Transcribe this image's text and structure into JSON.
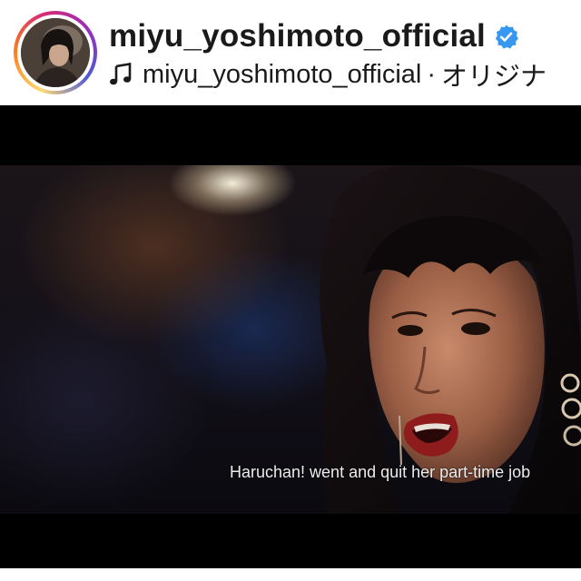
{
  "header": {
    "username": "miyu_yoshimoto_official",
    "verified": true,
    "audio": {
      "artist": "miyu_yoshimoto_official",
      "separator": "·",
      "label": "オリジナ"
    },
    "icons": {
      "avatar": "profile-avatar",
      "verified": "verified-badge-icon",
      "music": "music-note-icon"
    }
  },
  "video": {
    "subtitle": "Haruchan! went and quit her part-time job"
  },
  "colors": {
    "verified_blue": "#3897f0",
    "text": "#1a1a1a",
    "subtitle": "#ececec"
  }
}
